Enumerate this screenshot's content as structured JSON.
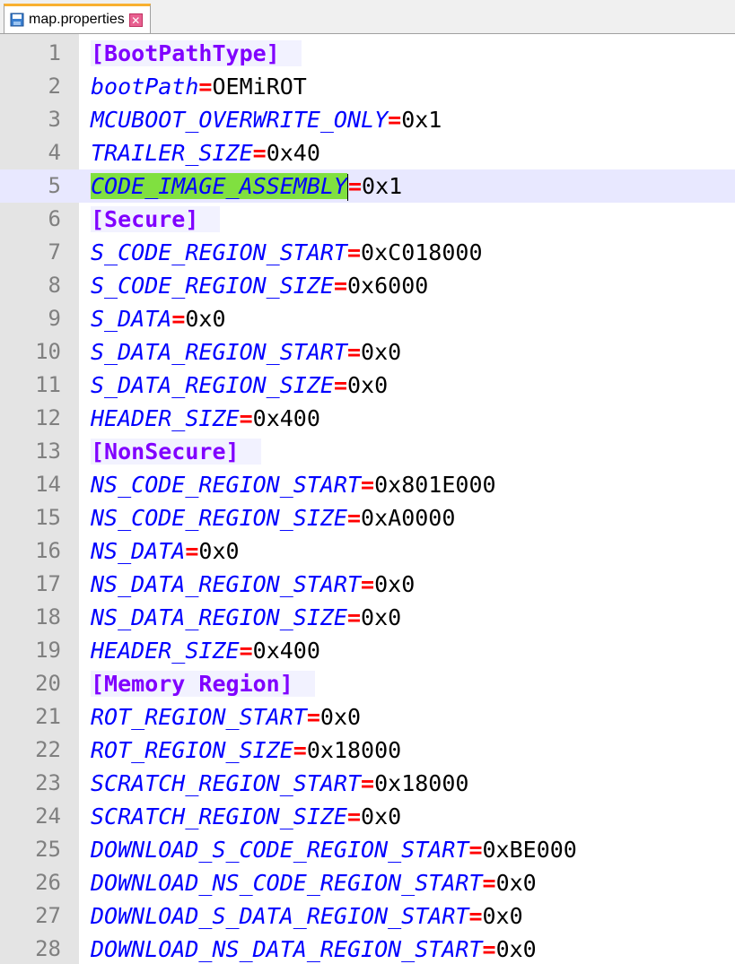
{
  "tab": {
    "title": "map.properties",
    "close_glyph": "✕"
  },
  "colors": {
    "section": "#8000ff",
    "key": "#0000ff",
    "equals": "#ff0000",
    "value": "#000000",
    "selection": "#80e040",
    "current_line": "#e8e8ff",
    "gutter": "#e4e4e4"
  },
  "current_line": 5,
  "lines": [
    {
      "n": "1",
      "section": "[BootPathType]"
    },
    {
      "n": "2",
      "key": "bootPath",
      "value": "OEMiROT"
    },
    {
      "n": "3",
      "key": "MCUBOOT_OVERWRITE_ONLY",
      "value": "0x1"
    },
    {
      "n": "4",
      "key": "TRAILER_SIZE",
      "value": "0x40"
    },
    {
      "n": "5",
      "key": "CODE_IMAGE_ASSEMBLY",
      "value": "0x1",
      "selected": true
    },
    {
      "n": "6",
      "section": "[Secure]"
    },
    {
      "n": "7",
      "key": "S_CODE_REGION_START",
      "value": "0xC018000"
    },
    {
      "n": "8",
      "key": "S_CODE_REGION_SIZE",
      "value": "0x6000"
    },
    {
      "n": "9",
      "key": "S_DATA",
      "value": "0x0"
    },
    {
      "n": "10",
      "key": "S_DATA_REGION_START",
      "value": "0x0"
    },
    {
      "n": "11",
      "key": "S_DATA_REGION_SIZE",
      "value": "0x0"
    },
    {
      "n": "12",
      "key": "HEADER_SIZE",
      "value": "0x400"
    },
    {
      "n": "13",
      "section": "[NonSecure]"
    },
    {
      "n": "14",
      "key": "NS_CODE_REGION_START",
      "value": "0x801E000"
    },
    {
      "n": "15",
      "key": "NS_CODE_REGION_SIZE",
      "value": "0xA0000"
    },
    {
      "n": "16",
      "key": "NS_DATA",
      "value": "0x0"
    },
    {
      "n": "17",
      "key": "NS_DATA_REGION_START",
      "value": "0x0"
    },
    {
      "n": "18",
      "key": "NS_DATA_REGION_SIZE",
      "value": "0x0"
    },
    {
      "n": "19",
      "key": "HEADER_SIZE",
      "value": "0x400"
    },
    {
      "n": "20",
      "section": "[Memory Region]"
    },
    {
      "n": "21",
      "key": "ROT_REGION_START",
      "value": "0x0"
    },
    {
      "n": "22",
      "key": "ROT_REGION_SIZE",
      "value": "0x18000"
    },
    {
      "n": "23",
      "key": "SCRATCH_REGION_START",
      "value": "0x18000"
    },
    {
      "n": "24",
      "key": "SCRATCH_REGION_SIZE",
      "value": "0x0"
    },
    {
      "n": "25",
      "key": "DOWNLOAD_S_CODE_REGION_START",
      "value": "0xBE000"
    },
    {
      "n": "26",
      "key": "DOWNLOAD_NS_CODE_REGION_START",
      "value": "0x0"
    },
    {
      "n": "27",
      "key": "DOWNLOAD_S_DATA_REGION_START",
      "value": "0x0"
    },
    {
      "n": "28",
      "key": "DOWNLOAD_NS_DATA_REGION_START",
      "value": "0x0"
    }
  ]
}
